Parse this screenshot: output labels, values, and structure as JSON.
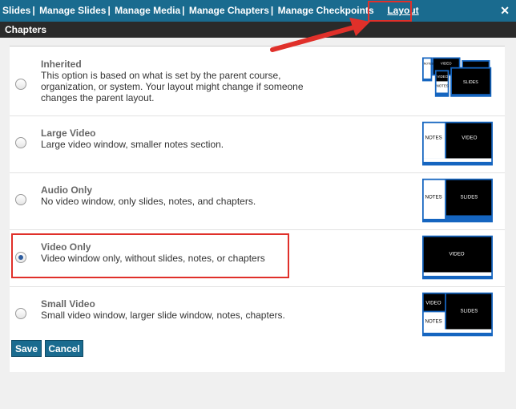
{
  "nav": {
    "items": [
      {
        "label": "Slides"
      },
      {
        "label": "Manage Slides"
      },
      {
        "label": "Manage Media"
      },
      {
        "label": "Manage Chapters"
      },
      {
        "label": "Manage Checkpoints"
      }
    ],
    "separator": "|",
    "active": "Layout",
    "close": "✕"
  },
  "section": {
    "title": "Chapters"
  },
  "options": [
    {
      "title": "Inherited",
      "desc": "This option is based on what is set by the parent course, organization, or system. Your layout might change if someone changes the parent layout.",
      "selected": false
    },
    {
      "title": "Large Video",
      "desc": "Large video window, smaller notes section.",
      "selected": false
    },
    {
      "title": "Audio Only",
      "desc": "No video window, only slides, notes, and chapters.",
      "selected": false
    },
    {
      "title": "Video Only",
      "desc": "Video window only, without slides, notes, or chapters",
      "selected": true
    },
    {
      "title": "Small Video",
      "desc": "Small video window, larger slide window, notes, chapters.",
      "selected": false
    }
  ],
  "thumb_labels": {
    "notes": "NOTES",
    "video": "VIDEO",
    "slides": "SLIDES"
  },
  "buttons": {
    "save": "Save",
    "cancel": "Cancel"
  },
  "colors": {
    "brand": "#1a6b8f",
    "section": "#2a2a2a",
    "highlight": "#e0302a",
    "thumb_blue": "#1565c0"
  }
}
